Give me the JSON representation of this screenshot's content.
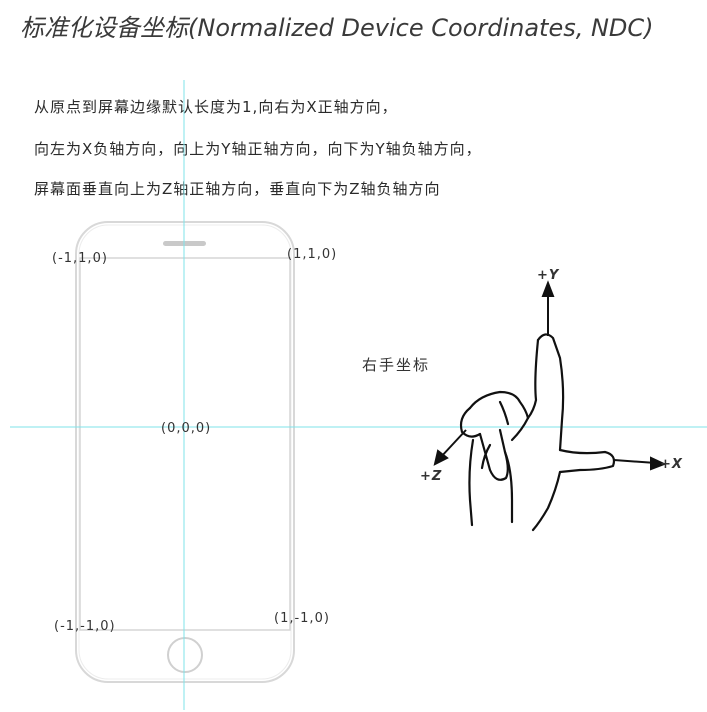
{
  "title": "标准化设备坐标(Normalized Device Coordinates, NDC)",
  "description": [
    "从原点到屏幕边缘默认长度为1,向右为X正轴方向，",
    "向左为X负轴方向，向上为Y轴正轴方向，向下为Y轴负轴方向，",
    "屏幕面垂直向上为Z轴正轴方向，垂直向下为Z轴负轴方向"
  ],
  "coords": {
    "top_left": "(-1,1,0)",
    "top_right": "(1,1,0)",
    "center": "(0,0,0)",
    "bottom_left": "(-1,-1,0)",
    "bottom_right": "(1,-1,0)"
  },
  "hand": {
    "label": "右手坐标",
    "axis_y": "+Y",
    "axis_x": "+X",
    "axis_z": "+Z"
  },
  "colors": {
    "axis_line": "#7fe3ea",
    "phone_outline": "#d6d6d6"
  }
}
